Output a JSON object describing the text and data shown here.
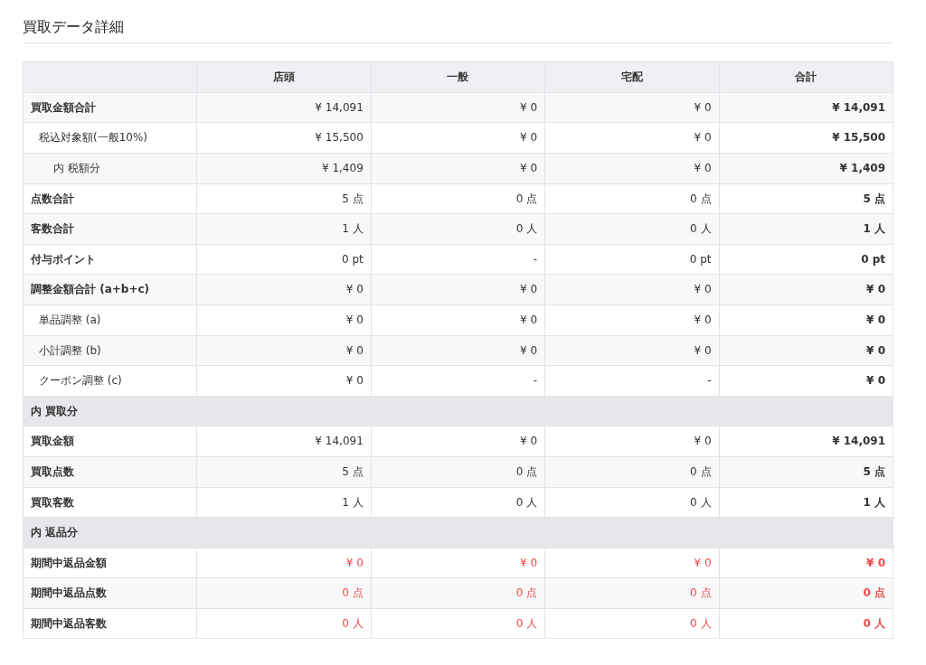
{
  "title": "買取データ詳細",
  "table": {
    "columns": [
      "",
      "店頭",
      "一般",
      "宅配",
      "合計"
    ],
    "rows": [
      {
        "kind": "row",
        "label": "買取金額合計",
        "negative": false,
        "values": [
          "¥ 14,091",
          "¥ 0",
          "¥ 0",
          "¥ 14,091"
        ],
        "children": [
          {
            "kind": "row",
            "label": "税込対象額(一般10%)",
            "negative": false,
            "values": [
              "¥ 15,500",
              "¥ 0",
              "¥ 0",
              "¥ 15,500"
            ],
            "children": [
              {
                "kind": "row",
                "label": "内 税額分",
                "negative": false,
                "values": [
                  "¥ 1,409",
                  "¥ 0",
                  "¥ 0",
                  "¥ 1,409"
                ]
              }
            ]
          }
        ]
      },
      {
        "kind": "row",
        "label": "点数合計",
        "negative": false,
        "values": [
          "5 点",
          "0 点",
          "0 点",
          "5 点"
        ]
      },
      {
        "kind": "row",
        "label": "客数合計",
        "negative": false,
        "values": [
          "1 人",
          "0 人",
          "0 人",
          "1 人"
        ]
      },
      {
        "kind": "row",
        "label": "付与ポイント",
        "negative": false,
        "values": [
          "0 pt",
          "-",
          "0 pt",
          "0 pt"
        ]
      },
      {
        "kind": "row",
        "label": "調整金額合計 (a+b+c)",
        "negative": false,
        "values": [
          "¥ 0",
          "¥ 0",
          "¥ 0",
          "¥ 0"
        ],
        "children": [
          {
            "kind": "row",
            "label": "単品調整 (a)",
            "negative": false,
            "values": [
              "¥ 0",
              "¥ 0",
              "¥ 0",
              "¥ 0"
            ]
          },
          {
            "kind": "row",
            "label": "小計調整 (b)",
            "negative": false,
            "values": [
              "¥ 0",
              "¥ 0",
              "¥ 0",
              "¥ 0"
            ]
          },
          {
            "kind": "row",
            "label": "クーポン調整 (c)",
            "negative": false,
            "values": [
              "¥ 0",
              "-",
              "-",
              "¥ 0"
            ]
          }
        ]
      },
      {
        "kind": "section",
        "label": "内 買取分"
      },
      {
        "kind": "row",
        "label": "買取金額",
        "negative": false,
        "values": [
          "¥ 14,091",
          "¥ 0",
          "¥ 0",
          "¥ 14,091"
        ]
      },
      {
        "kind": "row",
        "label": "買取点数",
        "negative": false,
        "values": [
          "5 点",
          "0 点",
          "0 点",
          "5 点"
        ]
      },
      {
        "kind": "row",
        "label": "買取客数",
        "negative": false,
        "values": [
          "1 人",
          "0 人",
          "0 人",
          "1 人"
        ]
      },
      {
        "kind": "section",
        "label": "内 返品分"
      },
      {
        "kind": "row",
        "label": "期間中返品金額",
        "negative": true,
        "values": [
          "¥ 0",
          "¥ 0",
          "¥ 0",
          "¥ 0"
        ]
      },
      {
        "kind": "row",
        "label": "期間中返品点数",
        "negative": true,
        "values": [
          "0 点",
          "0 点",
          "0 点",
          "0 点"
        ]
      },
      {
        "kind": "row",
        "label": "期間中返品客数",
        "negative": true,
        "values": [
          "0 人",
          "0 人",
          "0 人",
          "0 人"
        ]
      }
    ]
  }
}
